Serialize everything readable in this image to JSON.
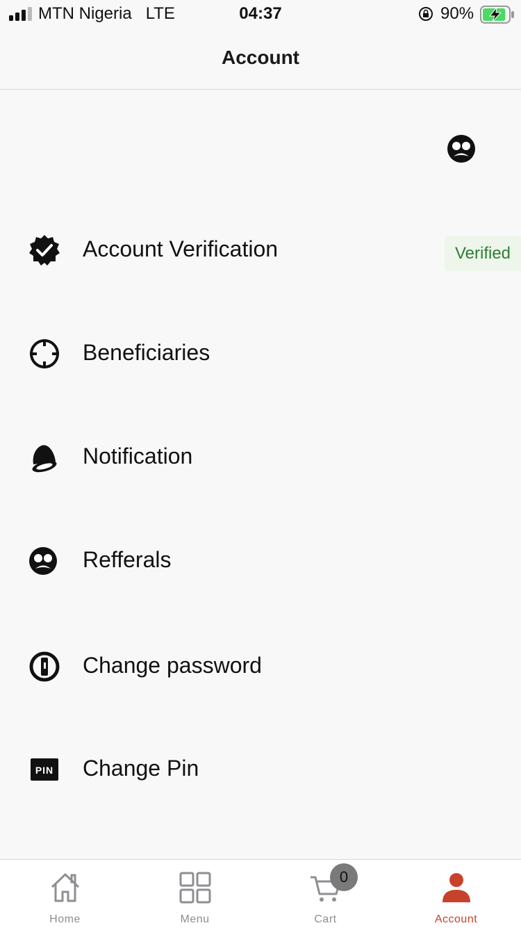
{
  "status_bar": {
    "carrier": "MTN Nigeria",
    "network": "LTE",
    "time": "04:37",
    "battery_percent": "90%",
    "battery_level": 0.9
  },
  "header": {
    "title": "Account"
  },
  "menu": {
    "items": [
      {
        "label": "Account Verification",
        "icon": "verified-badge-icon",
        "badge": "Verified"
      },
      {
        "label": "Beneficiaries",
        "icon": "crosshair-icon"
      },
      {
        "label": "Notification",
        "icon": "bell-icon"
      },
      {
        "label": "Refferals",
        "icon": "referral-face-icon"
      },
      {
        "label": "Change password",
        "icon": "password-keyhole-icon"
      },
      {
        "label": "Change Pin",
        "icon": "pin-icon",
        "icon_text": "PIN"
      }
    ]
  },
  "tab_bar": {
    "tabs": [
      {
        "label": "Home",
        "icon": "home-icon"
      },
      {
        "label": "Menu",
        "icon": "grid-icon"
      },
      {
        "label": "Cart",
        "icon": "cart-icon",
        "badge": "0"
      },
      {
        "label": "Account",
        "icon": "user-icon",
        "active": true
      }
    ]
  },
  "colors": {
    "accent": "#c8412b",
    "verified_text": "#2e7d32",
    "verified_bg": "#eef6ec",
    "background": "#f8f8f8",
    "inactive_tab": "#8e8e93"
  }
}
